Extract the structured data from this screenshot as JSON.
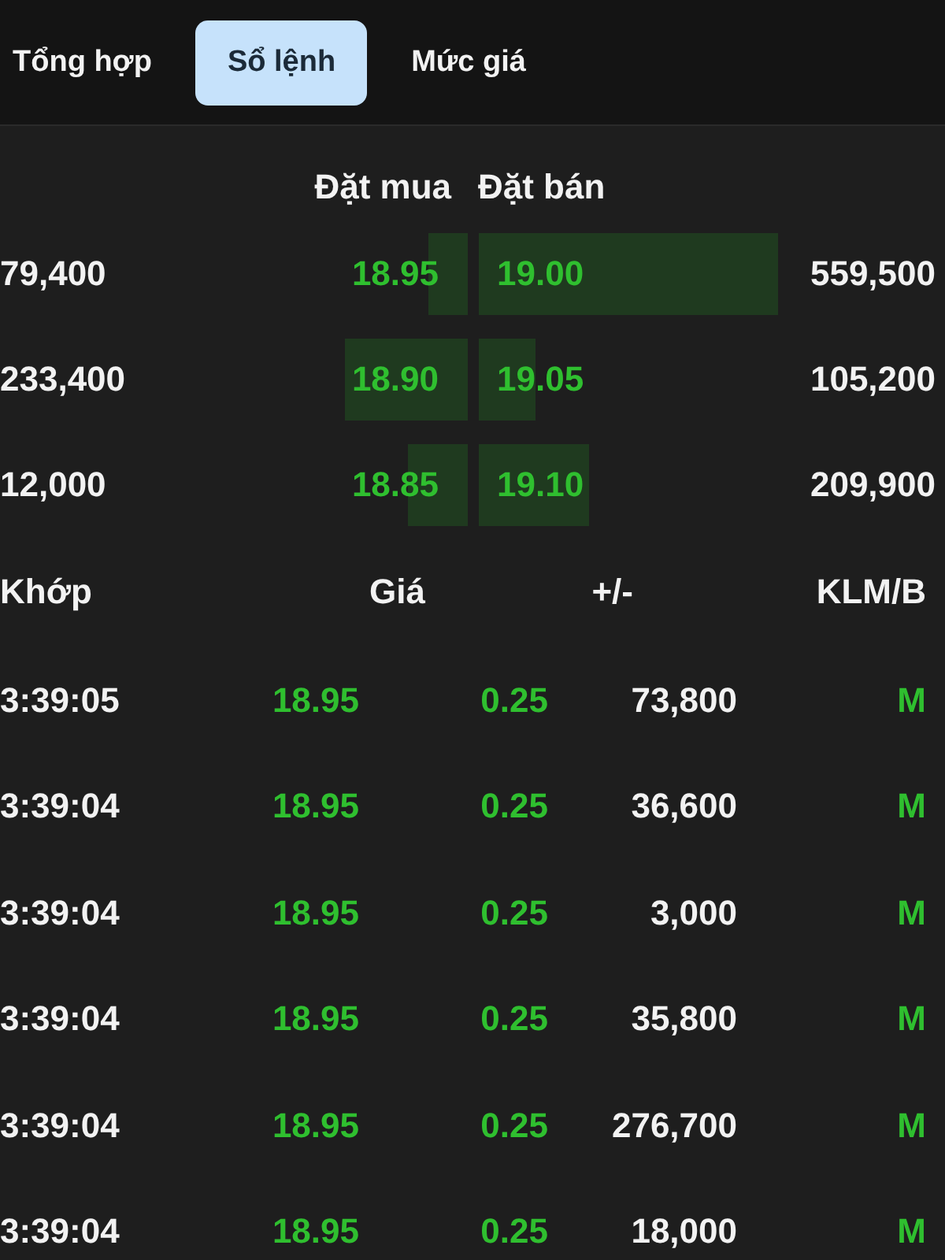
{
  "tabs": [
    {
      "label": "Tổng hợp",
      "selected": false
    },
    {
      "label": "Sổ lệnh",
      "selected": true
    },
    {
      "label": "Mức giá",
      "selected": false
    }
  ],
  "order_book": {
    "columns": [
      "Đặt mua",
      "Đặt bán"
    ],
    "rows": [
      {
        "bid": {
          "volume": "79,400",
          "price": "18.95",
          "level": 0.13
        },
        "ask": {
          "price": "19.00",
          "level": 1.0,
          "volume": "559,500"
        }
      },
      {
        "bid": {
          "volume": "233,400",
          "price": "18.90",
          "level": 0.41
        },
        "ask": {
          "price": "19.05",
          "level": 0.19,
          "volume": "105,200"
        }
      },
      {
        "bid": {
          "volume": "12,000",
          "price": "18.85",
          "level": 0.2
        },
        "ask": {
          "price": "19.10",
          "level": 0.37,
          "volume": "209,900"
        }
      }
    ]
  },
  "trades": {
    "columns": [
      "Khớp",
      "Giá",
      "+/-",
      "KLM/B"
    ],
    "rows": [
      {
        "time": "3:39:05",
        "price": "18.95",
        "change": "0.25",
        "volume": "73,800",
        "side": "M"
      },
      {
        "time": "3:39:04",
        "price": "18.95",
        "change": "0.25",
        "volume": "36,600",
        "side": "M"
      },
      {
        "time": "3:39:04",
        "price": "18.95",
        "change": "0.25",
        "volume": "3,000",
        "side": "M"
      },
      {
        "time": "3:39:04",
        "price": "18.95",
        "change": "0.25",
        "volume": "35,800",
        "side": "M"
      },
      {
        "time": "3:39:04",
        "price": "18.95",
        "change": "0.25",
        "volume": "276,700",
        "side": "M"
      },
      {
        "time": "3:39:04",
        "price": "18.95",
        "change": "0.25",
        "volume": "18,000",
        "side": "M"
      }
    ]
  }
}
